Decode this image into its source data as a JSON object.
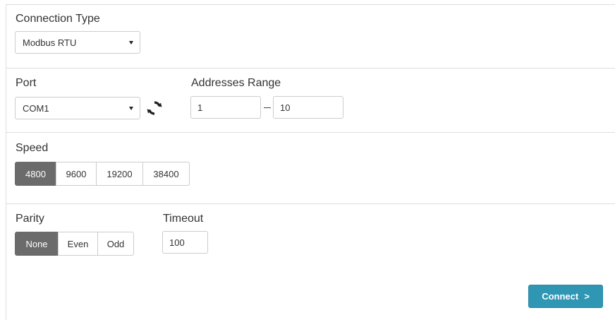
{
  "connection_type": {
    "label": "Connection Type",
    "selected": "Modbus RTU"
  },
  "port": {
    "label": "Port",
    "selected": "COM1",
    "refresh_icon": "refresh-icon"
  },
  "addresses_range": {
    "label": "Addresses Range",
    "from": "1",
    "to": "10"
  },
  "speed": {
    "label": "Speed",
    "options": [
      "4800",
      "9600",
      "19200",
      "38400"
    ],
    "selected": "4800"
  },
  "parity": {
    "label": "Parity",
    "options": [
      "None",
      "Even",
      "Odd"
    ],
    "selected": "None"
  },
  "timeout": {
    "label": "Timeout",
    "value": "100"
  },
  "actions": {
    "connect_label": "Connect",
    "connect_chevron": ">"
  },
  "colors": {
    "accent": "#2f96b4",
    "active_segment": "#6b6b6b"
  }
}
